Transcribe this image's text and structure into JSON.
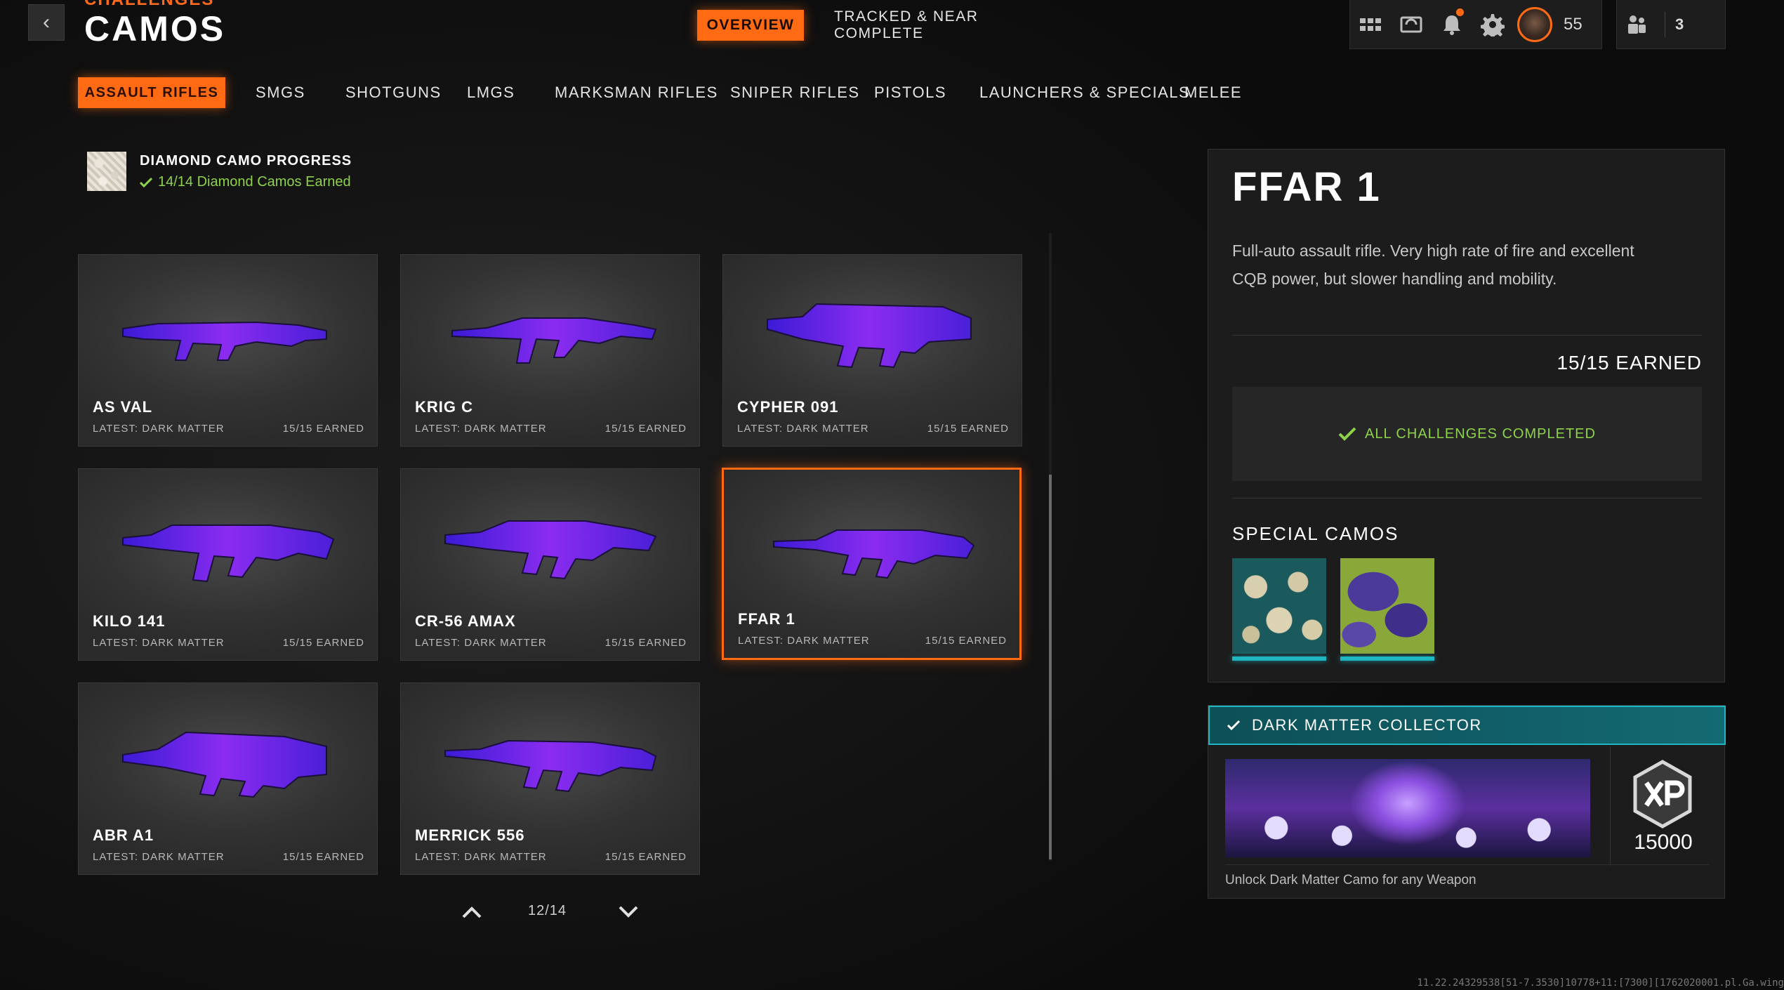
{
  "header": {
    "back_icon": "chevron-left-icon",
    "breadcrumb": "CHALLENGES",
    "title": "CAMOS",
    "tabs": [
      {
        "label": "OVERVIEW",
        "active": true
      },
      {
        "label": "TRACKED & NEAR COMPLETE",
        "active": false
      }
    ],
    "hud": {
      "icons": [
        "grid-menu-icon",
        "theater-icon",
        "bell-icon",
        "gear-icon"
      ],
      "player_level": "55",
      "party_count": "3"
    }
  },
  "categories": [
    {
      "label": "ASSAULT RIFLES",
      "active": true
    },
    {
      "label": "SMGS"
    },
    {
      "label": "SHOTGUNS"
    },
    {
      "label": "LMGS"
    },
    {
      "label": "MARKSMAN RIFLES"
    },
    {
      "label": "SNIPER RIFLES"
    },
    {
      "label": "PISTOLS"
    },
    {
      "label": "LAUNCHERS & SPECIALS"
    },
    {
      "label": "MELEE"
    }
  ],
  "diamond": {
    "title": "DIAMOND CAMO PROGRESS",
    "status": "14/14 Diamond Camos Earned"
  },
  "weapons": [
    {
      "name": "AS VAL",
      "latest": "LATEST: DARK MATTER",
      "earned": "15/15 EARNED"
    },
    {
      "name": "KRIG C",
      "latest": "LATEST: DARK MATTER",
      "earned": "15/15 EARNED"
    },
    {
      "name": "CYPHER 091",
      "latest": "LATEST: DARK MATTER",
      "earned": "15/15 EARNED"
    },
    {
      "name": "KILO 141",
      "latest": "LATEST: DARK MATTER",
      "earned": "15/15 EARNED"
    },
    {
      "name": "CR-56 AMAX",
      "latest": "LATEST: DARK MATTER",
      "earned": "15/15 EARNED"
    },
    {
      "name": "FFAR 1",
      "latest": "LATEST: DARK MATTER",
      "earned": "15/15 EARNED",
      "selected": true
    },
    {
      "name": "ABR A1",
      "latest": "LATEST: DARK MATTER",
      "earned": "15/15 EARNED"
    },
    {
      "name": "MERRICK 556",
      "latest": "LATEST: DARK MATTER",
      "earned": "15/15 EARNED"
    }
  ],
  "pager": {
    "text": "12/14"
  },
  "detail": {
    "name": "FFAR 1",
    "description": "Full-auto assault rifle.  Very high rate of fire and excellent CQB power, but slower handling and mobility.",
    "earned": "15/15 EARNED",
    "status": "ALL CHALLENGES COMPLETED",
    "special_title": "SPECIAL CAMOS"
  },
  "challenge": {
    "title": "DARK MATTER COLLECTOR",
    "xp": "15000",
    "description": "Unlock Dark Matter Camo for any Weapon"
  },
  "build": "11.22.24329538[51-7.3530]10778+11:[7300][1762020001.pl.Ga.wing"
}
